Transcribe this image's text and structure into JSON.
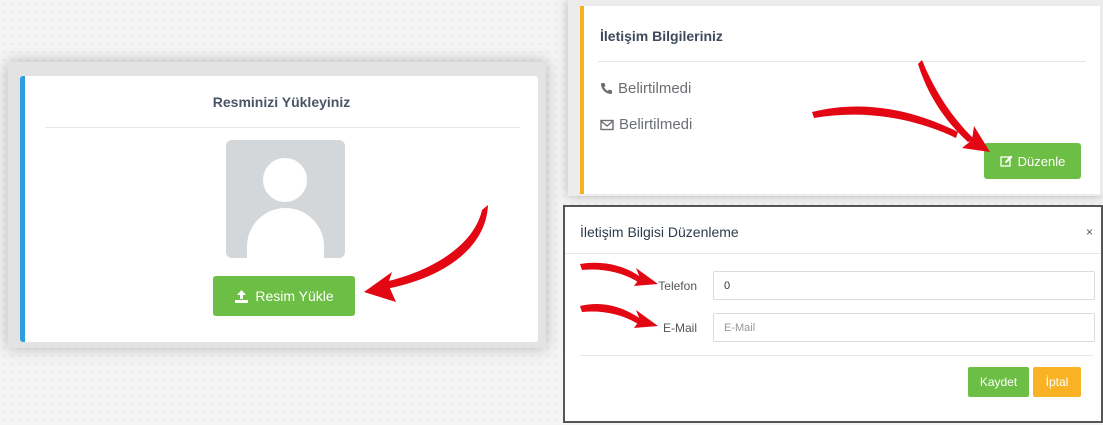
{
  "upload_panel": {
    "title": "Resminizi Yükleyiniz",
    "avatar_icon": "user-placeholder-icon",
    "upload_button": {
      "label": "Resim Yükle",
      "icon": "upload-icon"
    }
  },
  "contact_panel": {
    "title": "İletişim Bilgileriniz",
    "phone": {
      "icon": "phone-icon",
      "value": "Belirtilmedi"
    },
    "email": {
      "icon": "envelope-icon",
      "value": "Belirtilmedi"
    },
    "edit_button": {
      "label": "Düzenle",
      "icon": "edit-icon"
    }
  },
  "edit_modal": {
    "title": "İletişim Bilgisi Düzenleme",
    "close_label": "×",
    "phone_field": {
      "label": "Telefon",
      "value": "0"
    },
    "email_field": {
      "label": "E-Mail",
      "value": "",
      "placeholder": "E-Mail"
    },
    "save_label": "Kaydet",
    "cancel_label": "İptal"
  },
  "colors": {
    "success": "#6cbe45",
    "warning": "#f9b224",
    "upload_accent": "#2e9fdc",
    "contact_accent": "#f5b21c",
    "annotation_arrow": "#e30613"
  }
}
